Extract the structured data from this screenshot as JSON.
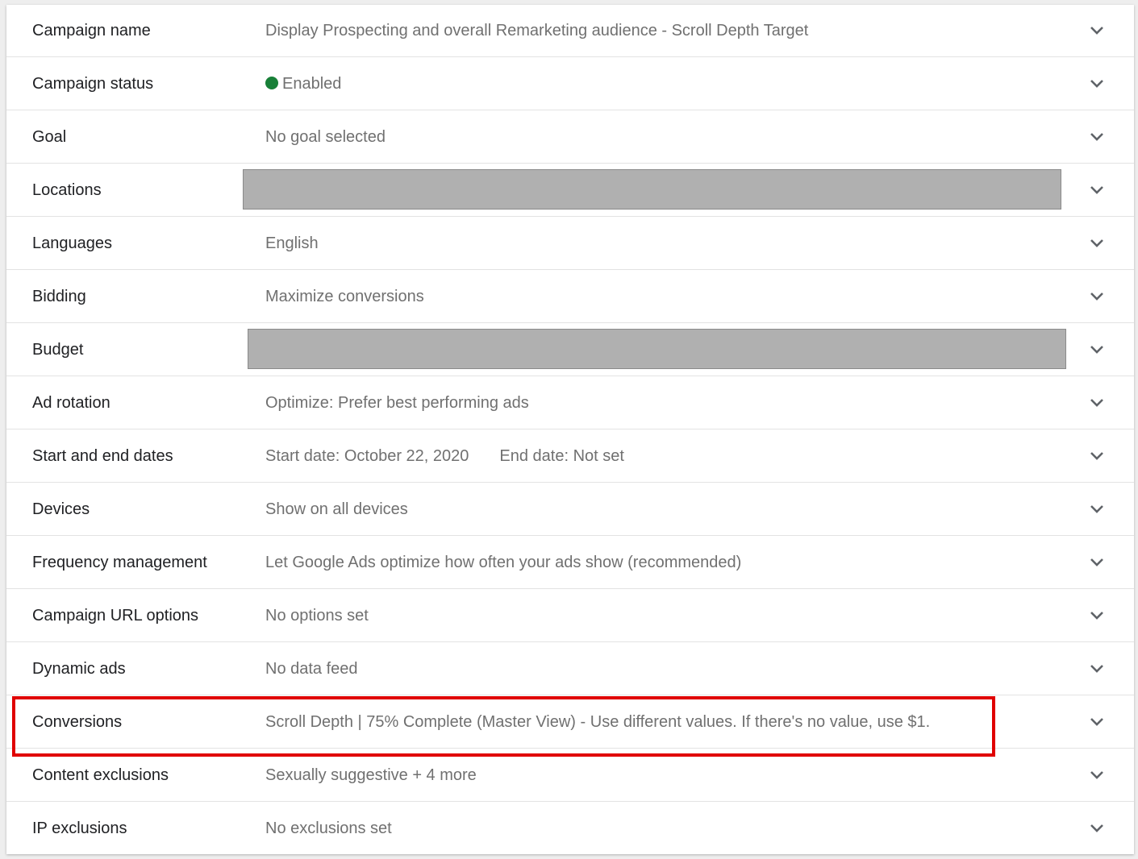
{
  "settings": {
    "rows": [
      {
        "label": "Campaign name",
        "value": "Display Prospecting and overall Remarketing audience - Scroll Depth Target"
      },
      {
        "label": "Campaign status",
        "value": "Enabled"
      },
      {
        "label": "Goal",
        "value": "No goal selected"
      },
      {
        "label": "Locations",
        "value": ""
      },
      {
        "label": "Languages",
        "value": "English"
      },
      {
        "label": "Bidding",
        "value": "Maximize conversions"
      },
      {
        "label": "Budget",
        "value": ""
      },
      {
        "label": "Ad rotation",
        "value": "Optimize: Prefer best performing ads"
      },
      {
        "label": "Start and end dates",
        "start": "Start date: October 22, 2020",
        "end": "End date: Not set"
      },
      {
        "label": "Devices",
        "value": "Show on all devices"
      },
      {
        "label": "Frequency management",
        "value": "Let Google Ads optimize how often your ads show (recommended)"
      },
      {
        "label": "Campaign URL options",
        "value": "No options set"
      },
      {
        "label": "Dynamic ads",
        "value": "No data feed"
      },
      {
        "label": "Conversions",
        "value": "Scroll Depth | 75% Complete (Master View) - Use different values. If there's no value, use $1."
      },
      {
        "label": "Content exclusions",
        "value": "Sexually suggestive + 4 more"
      },
      {
        "label": "IP exclusions",
        "value": "No exclusions set"
      }
    ],
    "expand_icon": "chevron-down-icon"
  },
  "colors": {
    "status_enabled": "#188038",
    "highlight": "#e00000",
    "redaction": "#b0b0b0"
  }
}
